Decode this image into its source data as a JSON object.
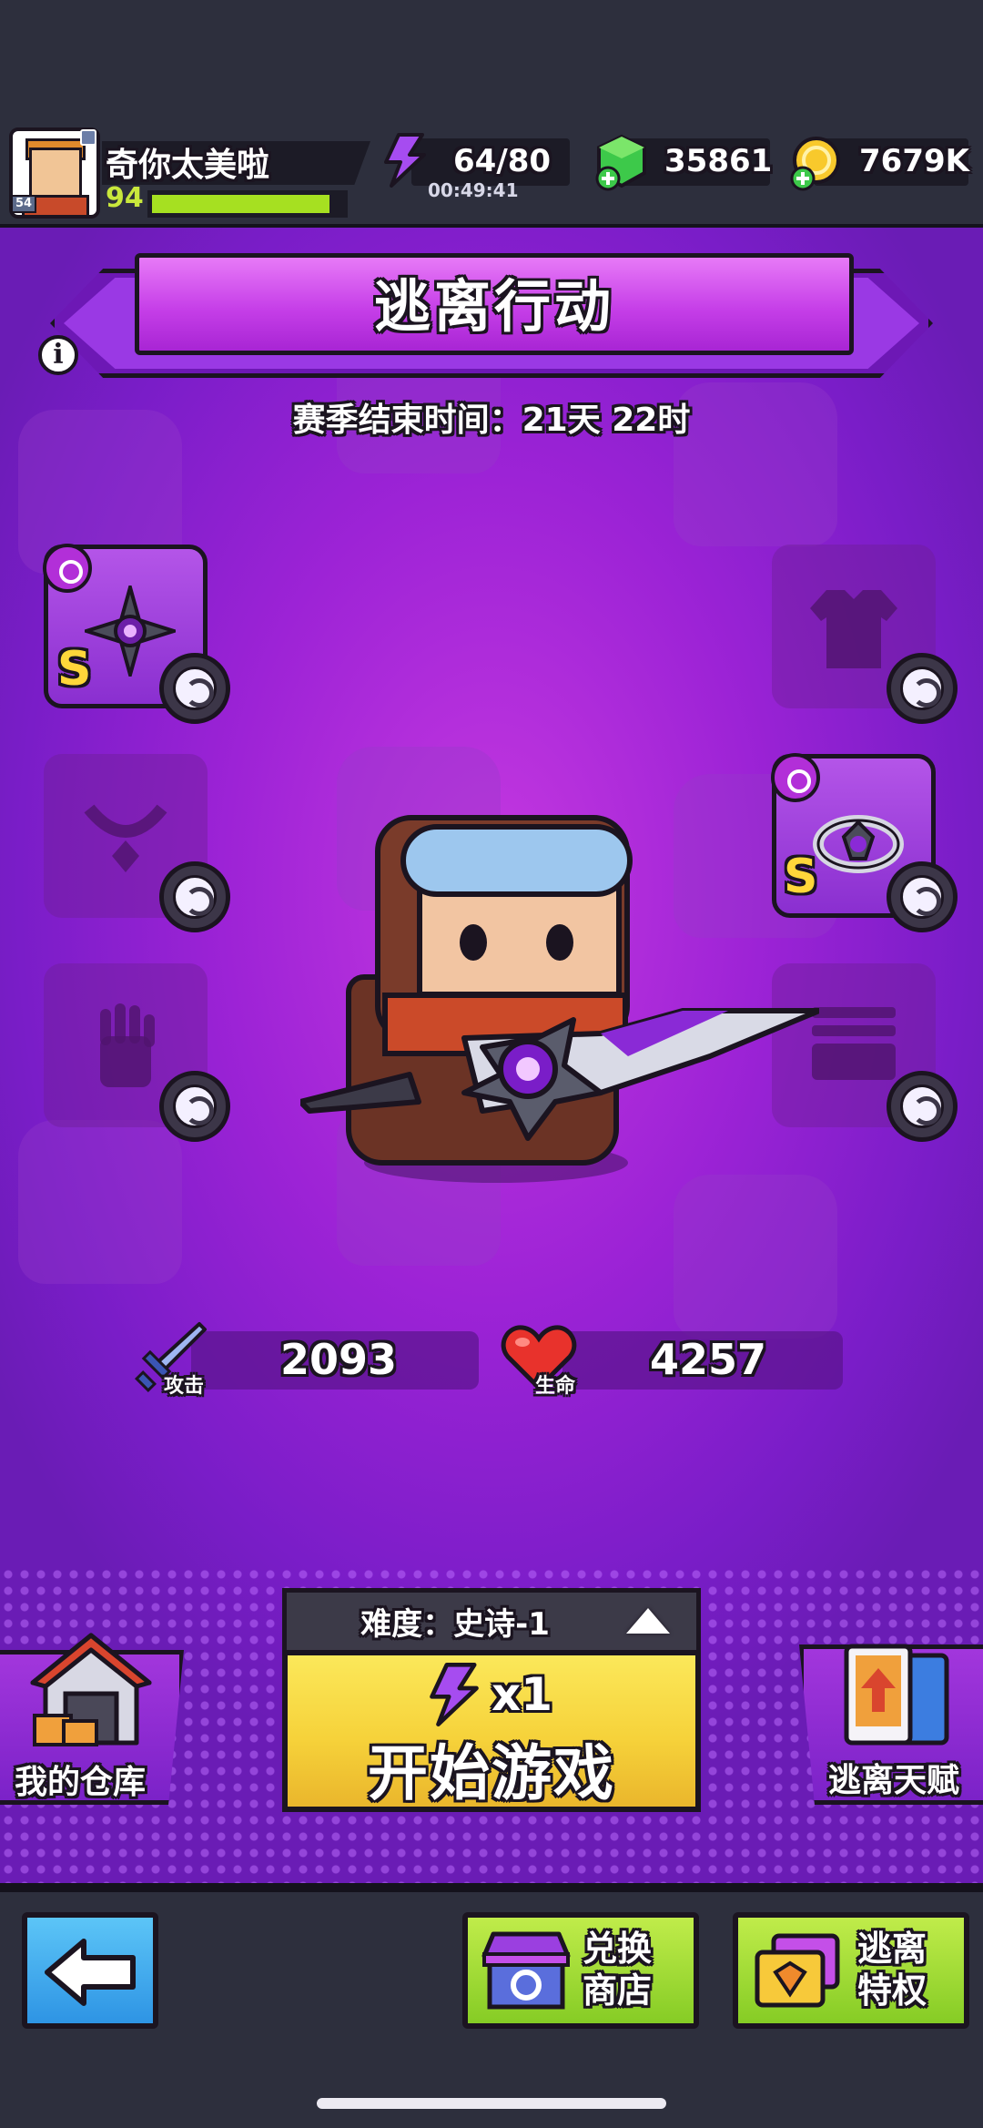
{
  "player": {
    "name": "奇你太美啦",
    "level": "94",
    "avatar_badge": "54",
    "xp_fraction": 0.93
  },
  "resources": {
    "energy": "64/80",
    "energy_timer": "00:49:41",
    "gems": "35861",
    "coins": "7679K"
  },
  "mode": {
    "title": "逃离行动",
    "season_end": "赛季结束时间：21天 22时"
  },
  "equipment": {
    "weapon_rank": "S",
    "ring_rank": "S"
  },
  "stats": {
    "attack_label": "攻击",
    "attack_value": "2093",
    "hp_label": "生命",
    "hp_value": "4257"
  },
  "start": {
    "difficulty": "难度：史诗-1",
    "cost": "x1",
    "label": "开始游戏"
  },
  "side_buttons": {
    "warehouse": "我的仓库",
    "talent": "逃离天赋"
  },
  "nav": {
    "shop_line1": "兑换",
    "shop_line2": "商店",
    "privilege_line1": "逃离",
    "privilege_line2": "特权"
  },
  "colors": {
    "accent_purple": "#9d23d6",
    "start_yellow": "#f6d23a",
    "nav_green": "#9bd82f",
    "back_blue": "#3fa7ec",
    "xp_green": "#a6e021"
  }
}
